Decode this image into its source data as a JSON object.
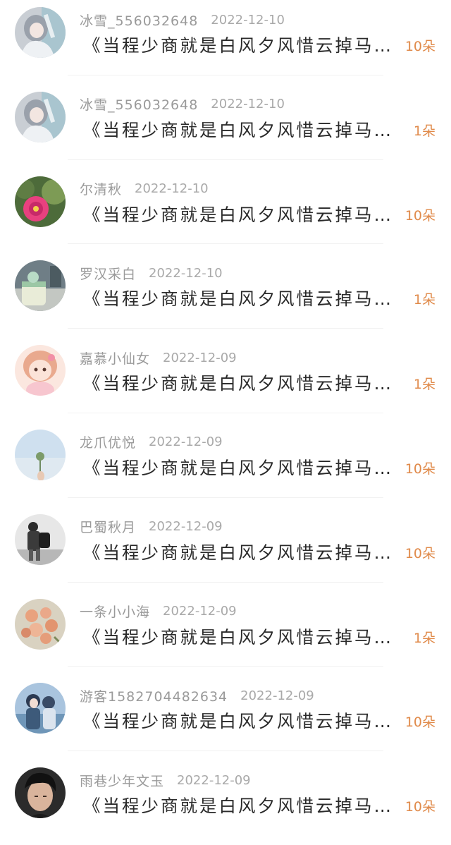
{
  "colors": {
    "username": "#9a9a9a",
    "date": "#a9a9a9",
    "title": "#2a2a2a",
    "count": "#e08a4a",
    "divider": "#f1f1f1"
  },
  "items": [
    {
      "username": "冰雪_556032648",
      "date": "2022-12-10",
      "title": "《当程少商就是白风夕风惜云掉马甲》",
      "count": "10朵",
      "avatar": "anime-girl-avatar"
    },
    {
      "username": "冰雪_556032648",
      "date": "2022-12-10",
      "title": "《当程少商就是白风夕风惜云掉马甲》",
      "count": "1朵",
      "avatar": "anime-girl-avatar"
    },
    {
      "username": "尔清秋",
      "date": "2022-12-10",
      "title": "《当程少商就是白风夕风惜云掉马甲》",
      "count": "10朵",
      "avatar": "cactus-flower-avatar"
    },
    {
      "username": "罗汉采白",
      "date": "2022-12-10",
      "title": "《当程少商就是白风夕风惜云掉马甲》",
      "count": "1朵",
      "avatar": "cake-avatar"
    },
    {
      "username": "嘉慕小仙女",
      "date": "2022-12-09",
      "title": "《当程少商就是白风夕风惜云掉马甲》",
      "count": "1朵",
      "avatar": "cartoon-girl-avatar"
    },
    {
      "username": "龙爪优悦",
      "date": "2022-12-09",
      "title": "《当程少商就是白风夕风惜云掉马甲》",
      "count": "10朵",
      "avatar": "sky-plant-avatar"
    },
    {
      "username": "巴蜀秋月",
      "date": "2022-12-09",
      "title": "《当程少商就是白风夕风惜云掉马甲》",
      "count": "10朵",
      "avatar": "backpack-person-avatar"
    },
    {
      "username": "一条小小海",
      "date": "2022-12-09",
      "title": "《当程少商就是白风夕风惜云掉马甲》",
      "count": "1朵",
      "avatar": "roses-avatar"
    },
    {
      "username": "游客1582704482634",
      "date": "2022-12-09",
      "title": "《当程少商就是白风夕风惜云掉马甲》",
      "count": "10朵",
      "avatar": "anime-couple-avatar"
    },
    {
      "username": "雨巷少年文玉",
      "date": "2022-12-09",
      "title": "《当程少商就是白风夕风惜云掉马甲》",
      "count": "10朵",
      "avatar": "man-portrait-avatar"
    }
  ]
}
